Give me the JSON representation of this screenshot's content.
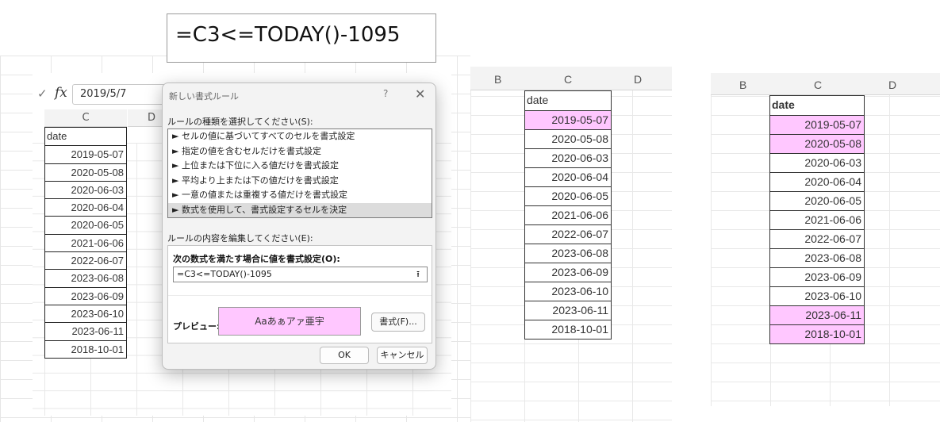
{
  "caption": {
    "formula": "=C3<=TODAY()-1095"
  },
  "panel1": {
    "formula_bar": {
      "check": "✓",
      "fx": "fx",
      "value": "2019/5/7"
    },
    "col_headers": [
      "C",
      "D"
    ],
    "table": {
      "header": "date",
      "rows": [
        "2019-05-07",
        "2020-05-08",
        "2020-06-03",
        "2020-06-04",
        "2020-06-05",
        "2021-06-06",
        "2022-06-07",
        "2023-06-08",
        "2023-06-09",
        "2023-06-10",
        "2023-06-11",
        "2018-10-01"
      ]
    },
    "dialog": {
      "title": "新しい書式ルール",
      "help": "?",
      "close": "✕",
      "select_label": "ルールの種類を選択してください(S):",
      "rule_types": [
        "► セルの値に基づいてすべてのセルを書式設定",
        "► 指定の値を含むセルだけを書式設定",
        "► 上位または下位に入る値だけを書式設定",
        "► 平均より上または下の値だけを書式設定",
        "► 一意の値または重複する値だけを書式設定",
        "► 数式を使用して、書式設定するセルを決定"
      ],
      "edit_label": "ルールの内容を編集してください(E):",
      "formula_label": "次の数式を満たす場合に値を書式設定(O):",
      "formula_value": "=C3<=TODAY()-1095",
      "preview_label": "プレビュー:",
      "preview_text": "Aaあぁアァ亜宇",
      "format_button": "書式(F)...",
      "ok_button": "OK",
      "cancel_button": "キャンセル"
    }
  },
  "panel2": {
    "col_headers": [
      "B",
      "C",
      "D"
    ],
    "table": {
      "header": "date",
      "rows": [
        "2019-05-07",
        "2020-05-08",
        "2020-06-03",
        "2020-06-04",
        "2020-06-05",
        "2021-06-06",
        "2022-06-07",
        "2023-06-08",
        "2023-06-09",
        "2023-06-10",
        "2023-06-11",
        "2018-10-01"
      ],
      "highlighted": [
        true,
        false,
        false,
        false,
        false,
        false,
        false,
        false,
        false,
        false,
        false,
        false
      ]
    }
  },
  "panel3": {
    "col_headers": [
      "B",
      "C",
      "D"
    ],
    "table": {
      "header": "date",
      "rows": [
        "2019-05-07",
        "2020-05-08",
        "2020-06-03",
        "2020-06-04",
        "2020-06-05",
        "2021-06-06",
        "2022-06-07",
        "2023-06-08",
        "2023-06-09",
        "2023-06-10",
        "2023-06-11",
        "2018-10-01"
      ],
      "highlighted": [
        true,
        true,
        false,
        false,
        false,
        false,
        false,
        false,
        false,
        false,
        true,
        true
      ]
    }
  },
  "colors": {
    "highlight": "#ffc7ff"
  }
}
